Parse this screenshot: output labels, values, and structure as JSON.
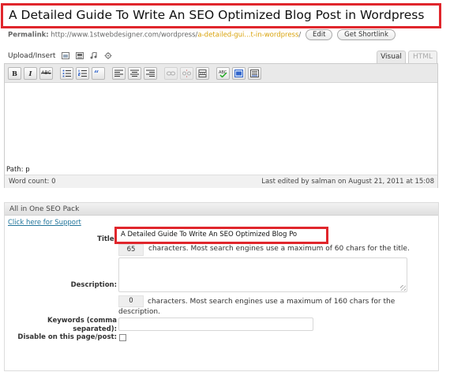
{
  "title": "A Detailed Guide To Write An SEO Optimized Blog Post in Wordpress",
  "permalink": {
    "label": "Permalink:",
    "base": "http://www.1stwebdesigner.com/wordpress/",
    "slug": "a-detailed-gui...t-in-wordpress",
    "suffix": "/",
    "edit_label": "Edit",
    "shortlink_label": "Get Shortlink"
  },
  "upload": {
    "label": "Upload/Insert",
    "icons": [
      "image-icon",
      "video-icon",
      "audio-icon",
      "media-icon"
    ]
  },
  "tabs": {
    "visual": "Visual",
    "html": "HTML"
  },
  "toolbar": {
    "bold": "B",
    "italic": "I",
    "strike": "ABC",
    "buttons": [
      "bold-button",
      "italic-button",
      "strikethrough-button",
      "bullet-list-button",
      "numbered-list-button",
      "blockquote-button",
      "align-left-button",
      "align-center-button",
      "align-right-button",
      "link-button",
      "unlink-button",
      "more-tag-button",
      "spellcheck-button",
      "fullscreen-button",
      "kitchen-sink-button"
    ]
  },
  "editor": {
    "path": "Path: p",
    "word_count": "Word count: 0",
    "last_edited": "Last edited by salman on August 21, 2011 at 15:08"
  },
  "seo": {
    "header": "All in One SEO Pack",
    "support_link": "Click here for Support",
    "title_label": "Title:",
    "title_value": "A Detailed Guide To Write An SEO Optimized Blog Po",
    "title_count": "65",
    "title_hint": "characters. Most search engines use a maximum of 60 chars for the title.",
    "description_label": "Description:",
    "description_count": "0",
    "description_hint": "characters. Most search engines use a maximum of 160 chars for the",
    "description_hint_2": "description.",
    "keywords_label": "Keywords (comma separated):",
    "disable_label": "Disable on this page/post:"
  },
  "colors": {
    "highlight": "#e0262c",
    "link": "#21759b",
    "slug": "#d9a20b"
  }
}
